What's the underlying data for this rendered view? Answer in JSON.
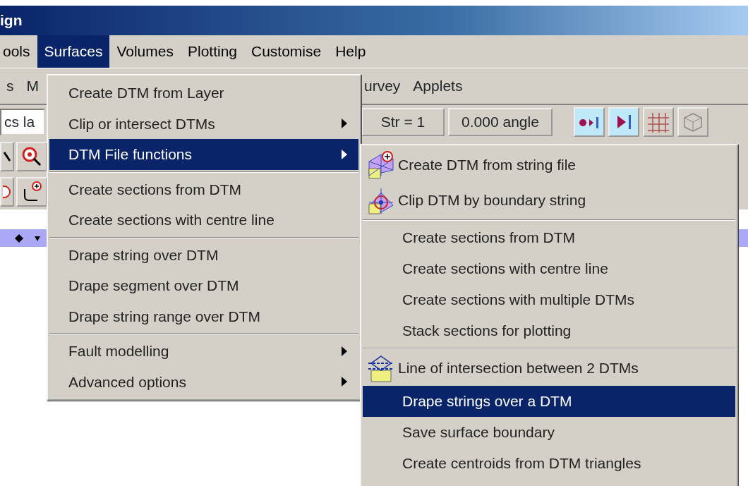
{
  "window": {
    "title": "ign"
  },
  "menubar": [
    {
      "label": "ools",
      "selected": false
    },
    {
      "label": "Surfaces",
      "selected": true
    },
    {
      "label": "Volumes",
      "selected": false
    },
    {
      "label": "Plotting",
      "selected": false
    },
    {
      "label": "Customise",
      "selected": false
    },
    {
      "label": "Help",
      "selected": false
    }
  ],
  "second_menu_left": [
    "s",
    "M"
  ],
  "second_menu_right": [
    "urvey",
    "Applets"
  ],
  "toolbar": {
    "layer_field": "cs la",
    "string_field": "Str = 1",
    "angle_field": "0.000 angle"
  },
  "surfaces_menu": [
    {
      "kind": "item",
      "label": "Create DTM from Layer",
      "selected": false,
      "has_submenu": false
    },
    {
      "kind": "item",
      "label": "Clip or intersect DTMs",
      "selected": false,
      "has_submenu": true
    },
    {
      "kind": "item",
      "label": "DTM File functions",
      "selected": true,
      "has_submenu": true
    },
    {
      "kind": "separator"
    },
    {
      "kind": "item",
      "label": "Create sections from DTM",
      "selected": false,
      "has_submenu": false
    },
    {
      "kind": "item",
      "label": "Create sections with centre line",
      "selected": false,
      "has_submenu": false
    },
    {
      "kind": "separator"
    },
    {
      "kind": "item",
      "label": "Drape string over DTM",
      "selected": false,
      "has_submenu": false
    },
    {
      "kind": "item",
      "label": "Drape segment over DTM",
      "selected": false,
      "has_submenu": false
    },
    {
      "kind": "item",
      "label": "Drape string range over DTM",
      "selected": false,
      "has_submenu": false
    },
    {
      "kind": "separator"
    },
    {
      "kind": "item",
      "label": "Fault modelling",
      "selected": false,
      "has_submenu": true
    },
    {
      "kind": "item",
      "label": "Advanced options",
      "selected": false,
      "has_submenu": true
    }
  ],
  "dtm_file_functions_menu": [
    {
      "kind": "icon_item",
      "label": "Create DTM from string file",
      "selected": false
    },
    {
      "kind": "icon_item",
      "label": "Clip DTM by boundary string",
      "selected": false
    },
    {
      "kind": "separator"
    },
    {
      "kind": "item",
      "label": "Create sections from DTM",
      "selected": false
    },
    {
      "kind": "item",
      "label": "Create sections with centre line",
      "selected": false
    },
    {
      "kind": "item",
      "label": "Create sections with multiple DTMs",
      "selected": false
    },
    {
      "kind": "item",
      "label": "Stack sections for plotting",
      "selected": false
    },
    {
      "kind": "separator"
    },
    {
      "kind": "icon_item",
      "label": "Line of intersection between 2 DTMs",
      "selected": false
    },
    {
      "kind": "item",
      "label": "Drape strings over a DTM",
      "selected": true
    },
    {
      "kind": "item",
      "label": "Save surface boundary",
      "selected": false
    },
    {
      "kind": "item",
      "label": "Create centroids from DTM triangles",
      "selected": false
    }
  ]
}
